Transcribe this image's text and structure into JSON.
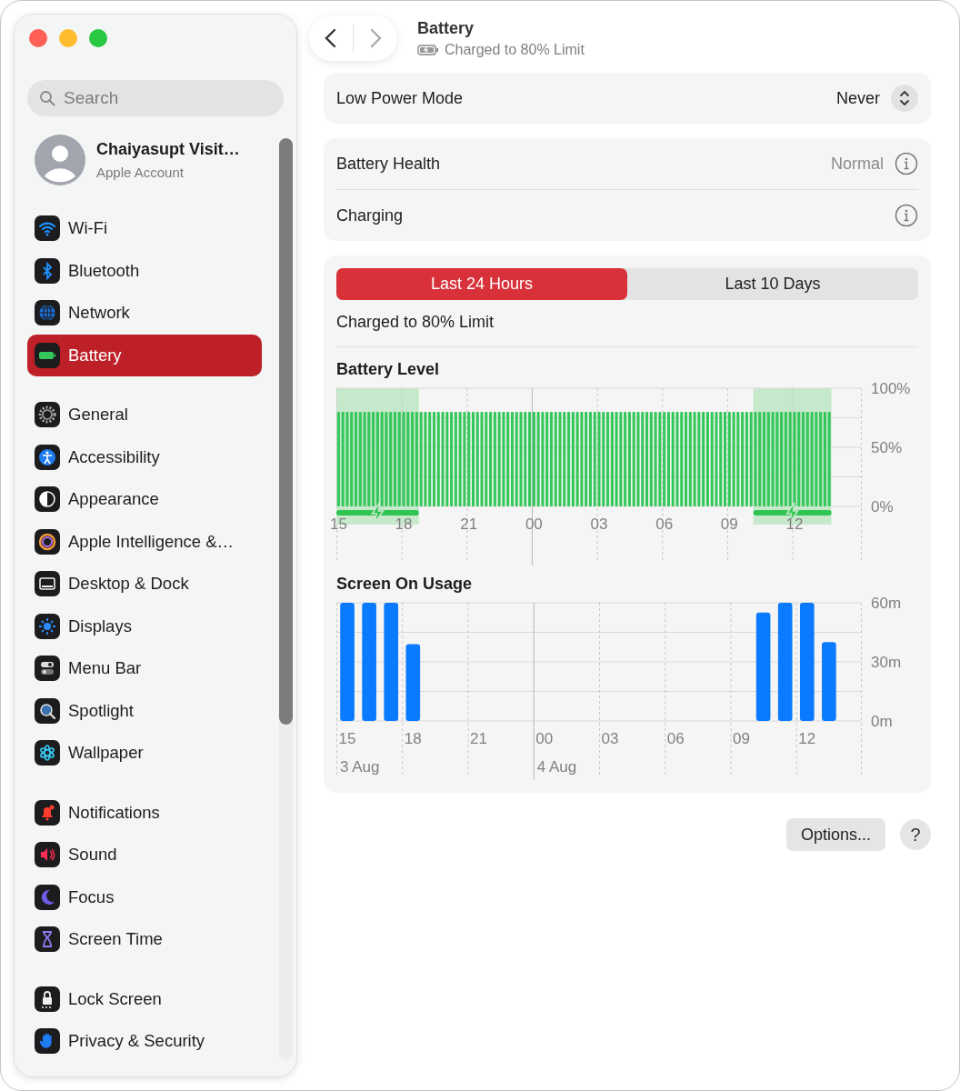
{
  "sidebar": {
    "search": {
      "placeholder": "Search"
    },
    "account": {
      "name": "Chaiyasupt Visit…",
      "subtitle": "Apple Account"
    },
    "groups": [
      [
        {
          "label": "Wi-Fi",
          "selected": false
        },
        {
          "label": "Bluetooth",
          "selected": false
        },
        {
          "label": "Network",
          "selected": false
        },
        {
          "label": "Battery",
          "selected": true
        }
      ],
      [
        {
          "label": "General",
          "selected": false
        },
        {
          "label": "Accessibility",
          "selected": false
        },
        {
          "label": "Appearance",
          "selected": false
        },
        {
          "label": "Apple Intelligence &…",
          "selected": false
        },
        {
          "label": "Desktop & Dock",
          "selected": false
        },
        {
          "label": "Displays",
          "selected": false
        },
        {
          "label": "Menu Bar",
          "selected": false
        },
        {
          "label": "Spotlight",
          "selected": false
        },
        {
          "label": "Wallpaper",
          "selected": false
        }
      ],
      [
        {
          "label": "Notifications",
          "selected": false
        },
        {
          "label": "Sound",
          "selected": false
        },
        {
          "label": "Focus",
          "selected": false
        },
        {
          "label": "Screen Time",
          "selected": false
        }
      ],
      [
        {
          "label": "Lock Screen",
          "selected": false
        },
        {
          "label": "Privacy & Security",
          "selected": false
        }
      ]
    ]
  },
  "header": {
    "title": "Battery",
    "subtitle": "Charged to 80% Limit"
  },
  "low_power_mode": {
    "label": "Low Power Mode",
    "value": "Never"
  },
  "info_rows": [
    {
      "label": "Battery Health",
      "value": "Normal"
    },
    {
      "label": "Charging"
    }
  ],
  "usage": {
    "tabs": [
      {
        "label": "Last 24 Hours",
        "selected": true
      },
      {
        "label": "Last 10 Days",
        "selected": false
      }
    ],
    "status": "Charged to 80% Limit",
    "charts": [
      {
        "chart_data": {
          "type": "bar",
          "title": "Battery Level",
          "ylim": [
            0,
            100
          ],
          "yticks": [
            {
              "value": 0,
              "label": "0%"
            },
            {
              "value": 50,
              "label": "50%"
            },
            {
              "value": 100,
              "label": "100%"
            }
          ],
          "categories": [
            "15",
            null,
            null,
            null,
            null,
            null,
            null,
            null,
            null,
            null,
            null,
            null,
            null,
            null,
            null,
            "18",
            null,
            null,
            null,
            null,
            null,
            null,
            null,
            null,
            null,
            null,
            null,
            null,
            null,
            null,
            "21",
            null,
            null,
            null,
            null,
            null,
            null,
            null,
            null,
            null,
            null,
            null,
            null,
            null,
            null,
            "00",
            null,
            null,
            null,
            null,
            null,
            null,
            null,
            null,
            null,
            null,
            null,
            null,
            null,
            null,
            "03",
            null,
            null,
            null,
            null,
            null,
            null,
            null,
            null,
            null,
            null,
            null,
            null,
            null,
            null,
            "06",
            null,
            null,
            null,
            null,
            null,
            null,
            null,
            null,
            null,
            null,
            null,
            null,
            null,
            null,
            "09",
            null,
            null,
            null,
            null,
            null,
            null,
            null,
            null,
            null,
            null,
            null,
            null,
            null,
            null,
            "12",
            null,
            null,
            null,
            null,
            null,
            null,
            null,
            null,
            null,
            null,
            null,
            null,
            null,
            null,
            null
          ],
          "series": [
            {
              "color": "#34c759",
              "values": [
                80,
                80,
                80,
                80,
                80,
                80,
                80,
                80,
                80,
                80,
                80,
                80,
                80,
                80,
                80,
                80,
                80,
                80,
                80,
                80,
                80,
                80,
                80,
                80,
                80,
                80,
                80,
                80,
                80,
                80,
                80,
                80,
                80,
                80,
                80,
                80,
                80,
                80,
                80,
                80,
                80,
                80,
                80,
                80,
                80,
                80,
                80,
                80,
                80,
                80,
                80,
                80,
                80,
                80,
                80,
                80,
                80,
                80,
                80,
                80,
                80,
                80,
                80,
                80,
                80,
                80,
                80,
                80,
                80,
                80,
                80,
                80,
                80,
                80,
                80,
                80,
                80,
                80,
                80,
                80,
                80,
                80,
                80,
                80,
                80,
                80,
                80,
                80,
                80,
                80,
                80,
                80,
                80,
                80,
                80,
                80,
                80,
                80,
                80,
                80,
                80,
                80,
                80,
                80,
                80,
                80,
                80,
                80,
                80,
                80,
                80,
                80,
                80,
                80,
                null,
                null,
                null,
                null,
                null,
                null,
                null
              ]
            }
          ],
          "ref_lines": [
            {
              "axis": "x",
              "value": "00"
            }
          ]
        }
      },
      {
        "chart_data": {
          "type": "bar",
          "title": "Screen On Usage",
          "ylim": [
            0,
            60
          ],
          "yticks": [
            {
              "value": 0,
              "label": "0m"
            },
            {
              "value": 30,
              "label": "30m"
            },
            {
              "value": 60,
              "label": "60m"
            }
          ],
          "categories": [
            "15",
            null,
            null,
            "18",
            null,
            null,
            "21",
            null,
            null,
            "00",
            null,
            null,
            "03",
            null,
            null,
            "06",
            null,
            null,
            "09",
            null,
            null,
            "12",
            null,
            null
          ],
          "series": [
            {
              "color": "#0a7aff",
              "values": [
                60,
                60,
                60,
                39,
                0,
                0,
                0,
                0,
                0,
                0,
                0,
                0,
                0,
                0,
                0,
                0,
                0,
                0,
                0,
                55,
                60,
                60,
                40,
                null
              ]
            }
          ],
          "ref_lines": [
            {
              "axis": "x",
              "value": "00"
            }
          ],
          "annotations": [
            "3 Aug",
            "4 Aug"
          ]
        }
      }
    ]
  },
  "buttons": {
    "options": "Options...",
    "help": "?"
  }
}
